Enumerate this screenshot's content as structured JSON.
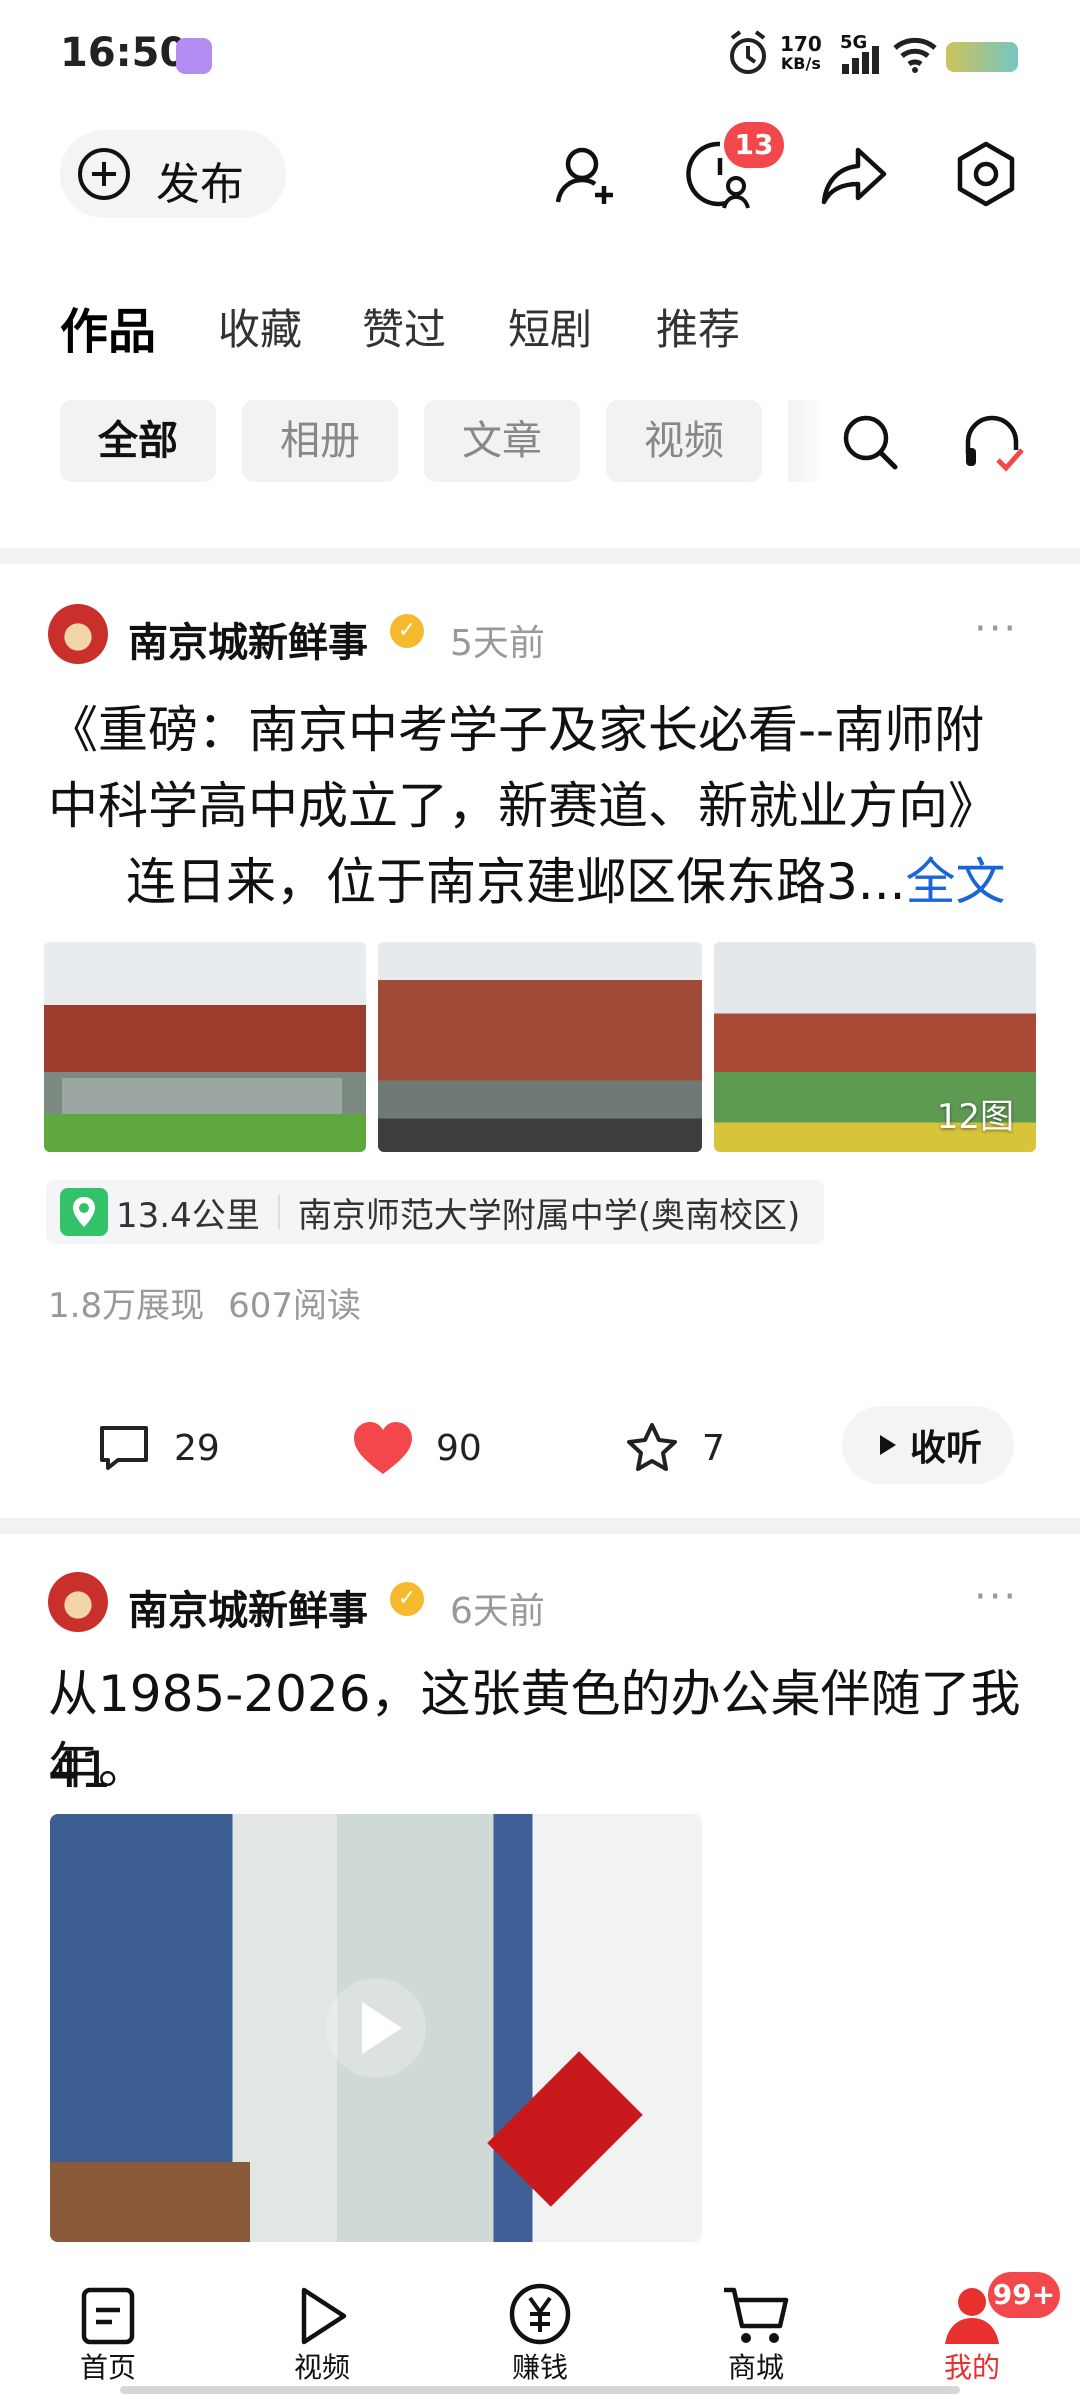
{
  "status_bar": {
    "time": "16:50",
    "net_speed_value": "170",
    "net_speed_unit": "KB/s",
    "signal": "5G"
  },
  "header": {
    "publish_label": "发布",
    "notification_count": "13"
  },
  "tabs": [
    {
      "label": "作品",
      "active": true
    },
    {
      "label": "收藏"
    },
    {
      "label": "赞过"
    },
    {
      "label": "短剧"
    },
    {
      "label": "推荐"
    }
  ],
  "filters": [
    {
      "label": "全部",
      "active": true
    },
    {
      "label": "相册"
    },
    {
      "label": "文章"
    },
    {
      "label": "视频"
    }
  ],
  "posts": [
    {
      "author": "南京城新鲜事",
      "time_ago": "5天前",
      "text_line1": "《重磅：南京中考学子及家长必看--南师附",
      "text_line2": "中科学高中成立了，新赛道、新就业方向》",
      "text_line3": "连日来，位于南京建邺区保东路3...",
      "read_more": "全文",
      "image_count": "12图",
      "distance": "13.4公里",
      "location": "南京师范大学附属中学(奥南校区)",
      "impressions": "1.8万展现",
      "reads": "607阅读",
      "comments": "29",
      "likes": "90",
      "favorites": "7",
      "listen_label": "收听"
    },
    {
      "author": "南京城新鲜事",
      "time_ago": "6天前",
      "text_line1": "从1985-2026，这张黄色的办公桌伴随了我41",
      "text_line2": "年。"
    }
  ],
  "bottom_nav": [
    {
      "label": "首页",
      "icon": "home-icon"
    },
    {
      "label": "视频",
      "icon": "play-icon"
    },
    {
      "label": "赚钱",
      "icon": "yuan-icon"
    },
    {
      "label": "商城",
      "icon": "cart-icon"
    },
    {
      "label": "我的",
      "icon": "profile-icon",
      "active": true,
      "badge": "99+"
    }
  ],
  "colors": {
    "accent_red": "#f2484b",
    "link_blue": "#1a66d6",
    "active_nav": "#e8302e"
  }
}
